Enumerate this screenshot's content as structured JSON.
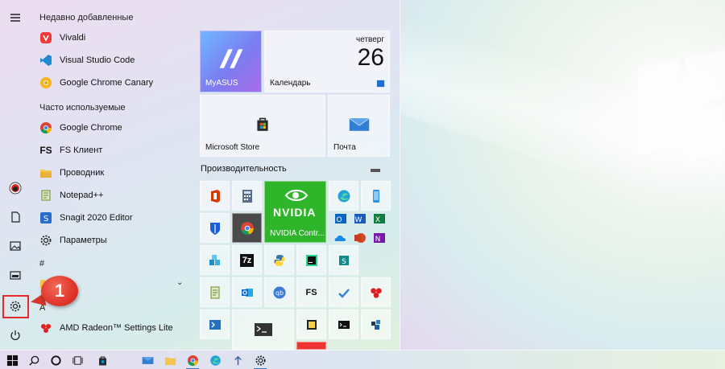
{
  "start_menu": {
    "recent_header": "Недавно добавленные",
    "recent": [
      {
        "label": "Vivaldi",
        "icon": "vivaldi-icon"
      },
      {
        "label": "Visual Studio Code",
        "icon": "vscode-icon"
      },
      {
        "label": "Google Chrome Canary",
        "icon": "chrome-canary-icon"
      }
    ],
    "frequent_header": "Часто используемые",
    "frequent": [
      {
        "label": "Google Chrome",
        "icon": "chrome-icon"
      },
      {
        "label": "FS Клиент",
        "icon": "fs-client-icon"
      },
      {
        "label": "Проводник",
        "icon": "file-explorer-icon"
      },
      {
        "label": "Notepad++",
        "icon": "notepadpp-icon"
      },
      {
        "label": "Snagit 2020 Editor",
        "icon": "snagit-icon"
      },
      {
        "label": "Параметры",
        "icon": "settings-gear-icon"
      }
    ],
    "hash_header": "#",
    "a_header": "A",
    "amd": {
      "label": "AMD Radeon™ Settings Lite",
      "icon": "amd-radeon-icon"
    }
  },
  "callout": {
    "number": "1"
  },
  "tiles": {
    "myasus": "MyASUS",
    "calendar": {
      "label": "Календарь",
      "weekday": "четверг",
      "day": "26"
    },
    "store": "Microsoft Store",
    "mail": "Почта",
    "group_header": "Производительность",
    "nvidia": {
      "logo": "NVIDIA",
      "label": "NVIDIA Contr..."
    },
    "seven_zip": "7z",
    "fs_tile": "FS"
  },
  "colors": {
    "accent": "#3a7bd5",
    "callout": "#e0352a",
    "nvidia": "#2fb52a",
    "highlight": "#e32b2b"
  }
}
